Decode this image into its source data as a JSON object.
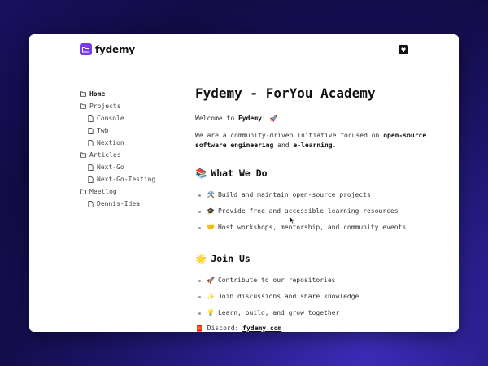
{
  "header": {
    "logo_text": "fydemy"
  },
  "sidebar": {
    "items": [
      {
        "label": "Home",
        "level": 1,
        "active": true
      },
      {
        "label": "Projects",
        "level": 1
      },
      {
        "label": "Console",
        "level": 2
      },
      {
        "label": "Twb",
        "level": 2
      },
      {
        "label": "Nextion",
        "level": 2
      },
      {
        "label": "Articles",
        "level": 1
      },
      {
        "label": "Next-Go",
        "level": 2
      },
      {
        "label": "Next-Go-Testing",
        "level": 2
      },
      {
        "label": "Meetlog",
        "level": 1
      },
      {
        "label": "Dennis-Idea",
        "level": 2
      }
    ]
  },
  "main": {
    "title": "Fydemy - ForYou Academy",
    "welcome_prefix": "Welcome to ",
    "welcome_bold": "Fydemy",
    "welcome_suffix": "! 🚀",
    "intro_prefix": "We are a community-driven initiative focused on ",
    "intro_bold1": "open-source software engineering",
    "intro_mid": " and ",
    "intro_bold2": "e-learning",
    "intro_suffix": ".",
    "what_we_do": {
      "emoji": "📚",
      "title": "What We Do",
      "items": [
        {
          "emoji": "🛠️",
          "text": "Build and maintain open-source projects"
        },
        {
          "emoji": "🎓",
          "text": "Provide free and accessible learning resources"
        },
        {
          "emoji": "🤝",
          "text": "Host workshops, mentorship, and community events"
        }
      ]
    },
    "join_us": {
      "emoji": "🌟",
      "title": "Join Us",
      "items": [
        {
          "emoji": "🚀",
          "text": "Contribute to our repositories"
        },
        {
          "emoji": "✨",
          "text": "Join discussions and share knowledge"
        },
        {
          "emoji": "💡",
          "text": "Learn, build, and grow together"
        }
      ]
    },
    "discord": {
      "emoji": "🧧",
      "label": "Discord: ",
      "link": "fydemy.com"
    }
  }
}
